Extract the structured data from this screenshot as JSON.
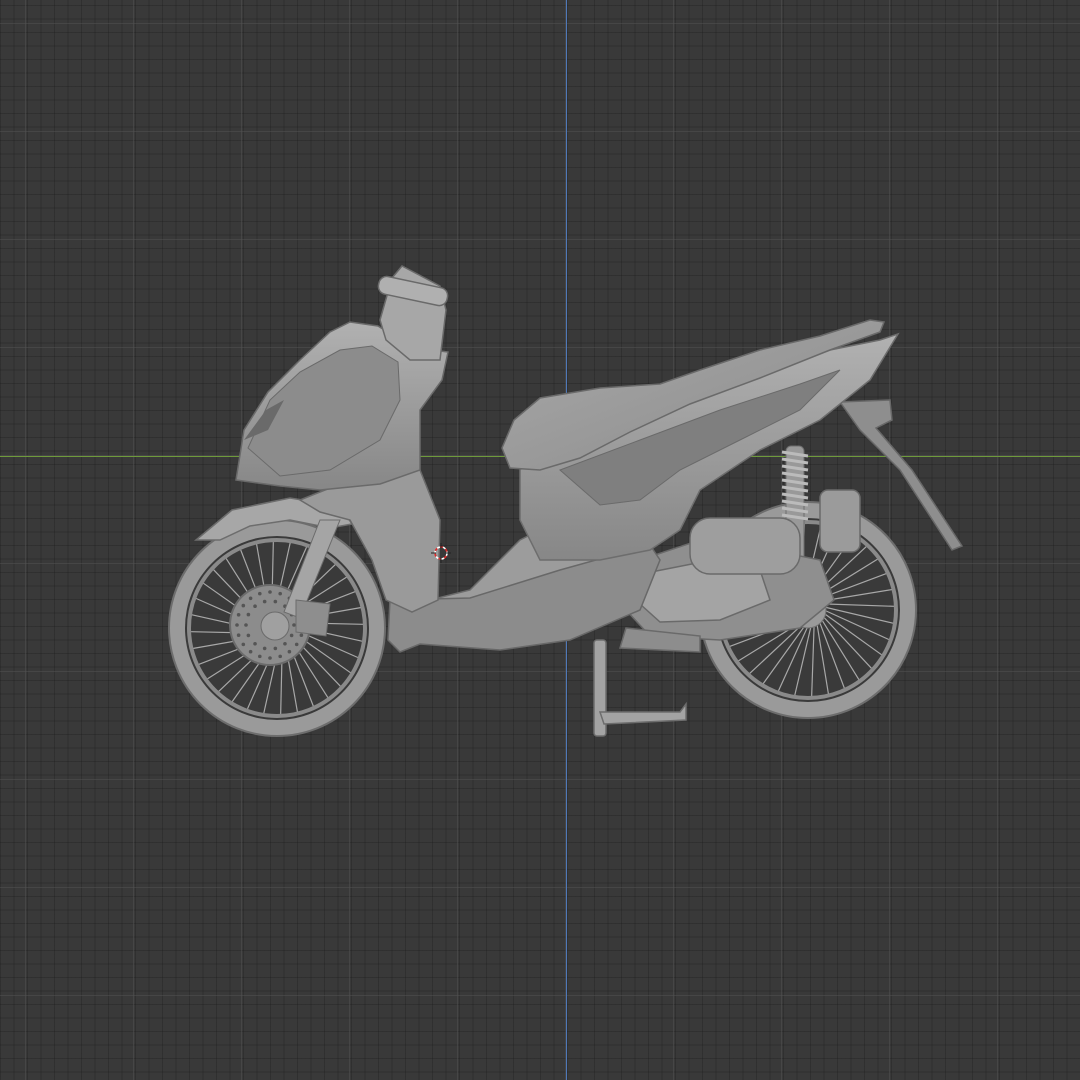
{
  "viewport": {
    "background_color": "#393939",
    "grid_visible": true,
    "grid_color": "#505050"
  },
  "axes": {
    "x_axis_color": "#6e9a3b",
    "z_axis_color": "#4f78b8"
  },
  "scene": {
    "object_name": "scooter-model",
    "shading": "solid",
    "model_color": "#9e9e9e"
  },
  "cursor_3d": {
    "icon": "3d-cursor-icon"
  }
}
